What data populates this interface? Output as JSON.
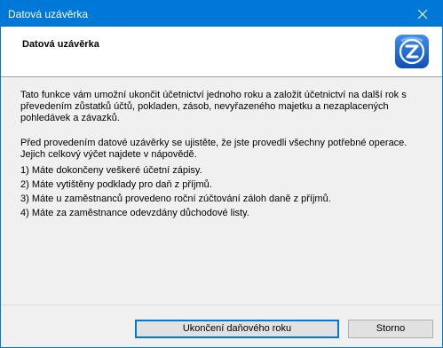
{
  "window": {
    "title": "Datová uzávěrka",
    "close_icon": "close-icon"
  },
  "header": {
    "title": "Datová uzávěrka",
    "logo_icon": "app-logo-icon",
    "logo_color": "#1f6fd6"
  },
  "body": {
    "intro": "Tato funkce vám umožní ukončit účetnictví jednoho roku a založit účetnictví na další rok s převedením zůstatků účtů, pokladen, zásob, nevyřazeného majetku a nezaplacených pohledávek a závazků.",
    "check_intro": "Před provedením datové uzávěrky se ujistěte, že jste provedli všechny potřebné operace. Jejich celkový výčet najdete v nápovědě.",
    "items": [
      "1) Máte dokončeny veškeré účetní zápisy.",
      "2) Máte vytištěny podklady pro daň z příjmů.",
      "3) Máte u zaměstnanců provedeno roční zúčtování záloh daně z příjmů.",
      "4) Máte za zaměstnance odevzdány důchodové listy."
    ]
  },
  "buttons": {
    "close_year": "Ukončení daňového roku",
    "cancel": "Storno"
  },
  "colors": {
    "titlebar": "#0078d7",
    "accent": "#0078d7"
  }
}
